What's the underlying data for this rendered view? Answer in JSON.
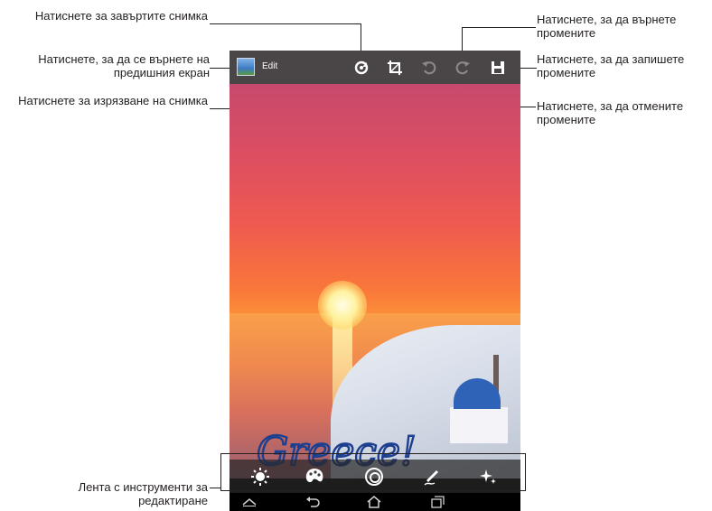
{
  "callouts": {
    "rotate": "Натиснете за завъртите снимка",
    "back": "Натиснете, за да се върнете на предишния екран",
    "crop": "Натиснете за изрязване на снимка",
    "redo": "Натиснете, за да върнете промените",
    "save": "Натиснете, за да запишете промените",
    "undo": "Натиснете, за да отмените промените",
    "toolbar": "Лента с инструменти за редактиране"
  },
  "topbar": {
    "title": "Edit",
    "icons": [
      "rotate-icon",
      "crop-icon",
      "undo-icon",
      "redo-icon",
      "save-icon"
    ]
  },
  "photo": {
    "handwriting": "Greece!"
  },
  "editbar": {
    "icons": [
      "brightness-icon",
      "palette-icon",
      "effects-icon",
      "draw-icon",
      "sparkle-icon"
    ]
  },
  "navbar": {
    "icons": [
      "up-arrow-icon",
      "back-icon",
      "home-icon",
      "recent-apps-icon"
    ]
  },
  "colors": {
    "topbar": "#4a4546",
    "accent_blue": "#2f63b8",
    "sunset_orange": "#f9773a"
  }
}
